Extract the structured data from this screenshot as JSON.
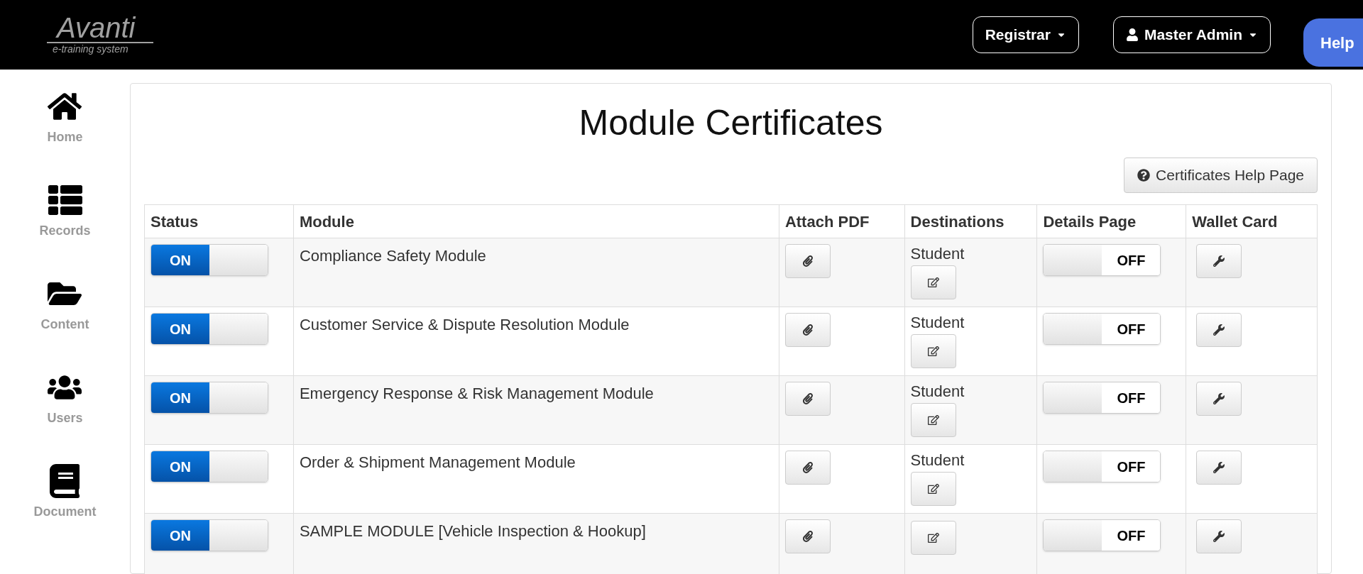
{
  "header": {
    "logo": {
      "name": "Avanti",
      "tagline": "e-training system"
    },
    "menus": [
      {
        "label": "Registrar",
        "kind": "plain"
      },
      {
        "label": "Master Admin",
        "kind": "user"
      }
    ],
    "help_button": "Help"
  },
  "sidebar": {
    "items": [
      {
        "label": "Home",
        "kind": "home"
      },
      {
        "label": "Records",
        "kind": "records"
      },
      {
        "label": "Content",
        "kind": "content"
      },
      {
        "label": "Users",
        "kind": "users"
      },
      {
        "label": "Document",
        "kind": "document"
      }
    ]
  },
  "page": {
    "title": "Module Certificates",
    "help_page_button": "Certificates Help Page"
  },
  "table": {
    "columns": [
      "Status",
      "Module",
      "Attach PDF",
      "Destinations",
      "Details Page",
      "Wallet Card"
    ],
    "rows": [
      {
        "status": {
          "on": true,
          "label": "ON"
        },
        "module": "Compliance Safety Module",
        "destination": "Student",
        "details": {
          "on": false,
          "label": "OFF"
        }
      },
      {
        "status": {
          "on": true,
          "label": "ON"
        },
        "module": "Customer Service & Dispute Resolution Module",
        "destination": "Student",
        "details": {
          "on": false,
          "label": "OFF"
        }
      },
      {
        "status": {
          "on": true,
          "label": "ON"
        },
        "module": "Emergency Response & Risk Management Module",
        "destination": "Student",
        "details": {
          "on": false,
          "label": "OFF"
        }
      },
      {
        "status": {
          "on": true,
          "label": "ON"
        },
        "module": "Order & Shipment Management Module",
        "destination": "Student",
        "details": {
          "on": false,
          "label": "OFF"
        }
      },
      {
        "status": {
          "on": true,
          "label": "ON"
        },
        "module": "SAMPLE MODULE [Vehicle Inspection & Hookup]",
        "details": {
          "on": false,
          "label": "OFF"
        }
      }
    ]
  }
}
